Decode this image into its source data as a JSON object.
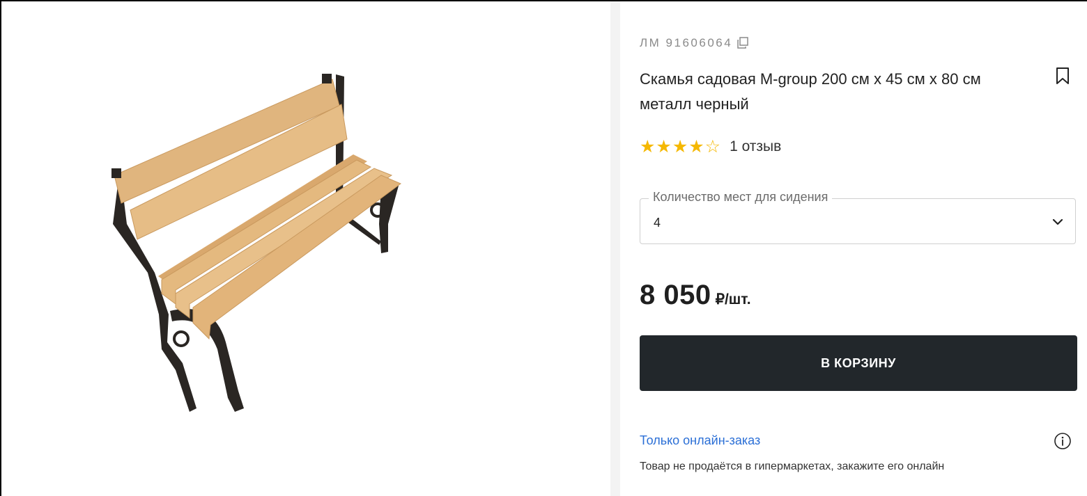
{
  "product": {
    "sku": "ЛМ 91606064",
    "title": "Скамья садовая M-group 200 см x 45 см x 80 см металл черный",
    "rating": {
      "value": 4,
      "max": 5,
      "stars_filled": "★★★★",
      "stars_empty": "☆",
      "reviews_text": "1 отзыв"
    },
    "seats_select": {
      "label": "Количество мест для сидения",
      "value": "4"
    },
    "price": {
      "value": "8 050",
      "unit": "₽/шт."
    },
    "cart_button_label": "В КОРЗИНУ",
    "online_only": {
      "link_text": "Только онлайн-заказ",
      "note": "Товар не продаётся в гипермаркетах, закажите его онлайн"
    }
  },
  "colors": {
    "accent_dark": "#22272b",
    "link_blue": "#2b6fd6",
    "star_yellow": "#f5b800",
    "wood": "#e0b57e",
    "metal": "#2a2623"
  },
  "icons": [
    "copy-icon",
    "bookmark-icon",
    "chevron-down-icon",
    "info-icon"
  ]
}
